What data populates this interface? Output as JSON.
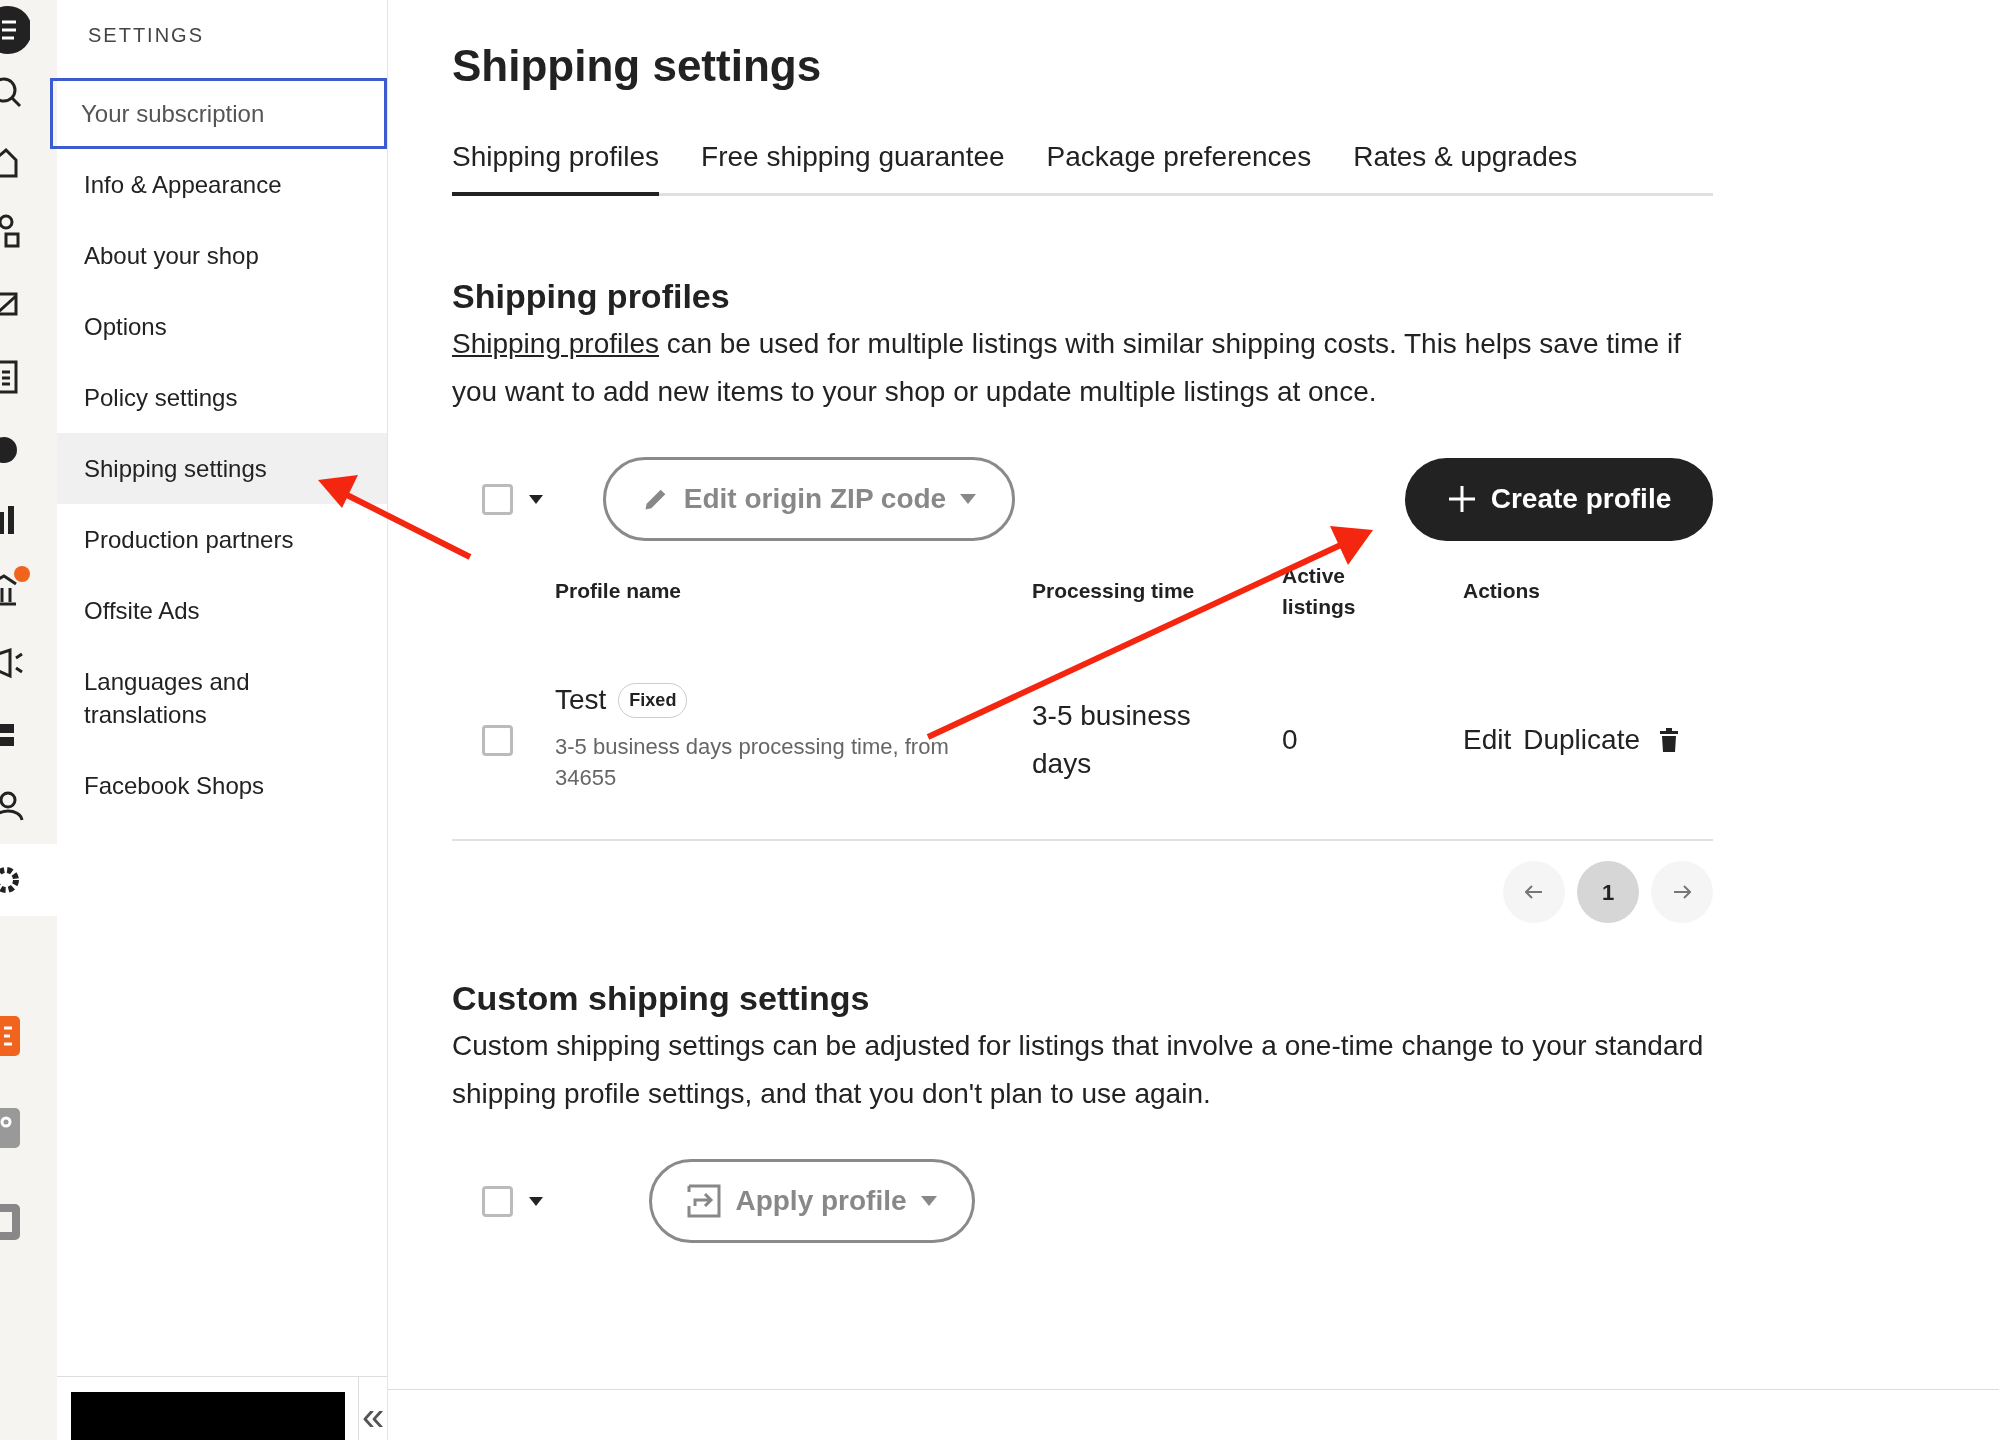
{
  "sidebar": {
    "heading": "SETTINGS",
    "items": [
      {
        "label": "Your subscription",
        "selected": false,
        "focused": true
      },
      {
        "label": "Info & Appearance",
        "selected": false,
        "focused": false
      },
      {
        "label": "About your shop",
        "selected": false,
        "focused": false
      },
      {
        "label": "Options",
        "selected": false,
        "focused": false
      },
      {
        "label": "Policy settings",
        "selected": false,
        "focused": false
      },
      {
        "label": "Shipping settings",
        "selected": true,
        "focused": false
      },
      {
        "label": "Production partners",
        "selected": false,
        "focused": false
      },
      {
        "label": "Offsite Ads",
        "selected": false,
        "focused": false
      },
      {
        "label": "Languages and translations",
        "selected": false,
        "focused": false
      },
      {
        "label": "Facebook Shops",
        "selected": false,
        "focused": false
      }
    ],
    "collapse": "«"
  },
  "page": {
    "title": "Shipping settings"
  },
  "tabs": [
    {
      "label": "Shipping profiles",
      "selected": true
    },
    {
      "label": "Free shipping guarantee",
      "selected": false
    },
    {
      "label": "Package preferences",
      "selected": false
    },
    {
      "label": "Rates & upgrades",
      "selected": false
    }
  ],
  "profiles": {
    "heading": "Shipping profiles",
    "link": "Shipping profiles",
    "text": " can be used for multiple listings with similar shipping costs. This helps save time if you want to add new items to your shop or update multiple listings at once.",
    "select_all": {
      "checked": false
    },
    "zip_button": "Edit origin ZIP code",
    "create_button": "Create profile",
    "columns": [
      "Profile name",
      "Processing time",
      "Active listings",
      "Actions"
    ],
    "rows": [
      {
        "checked": false,
        "name": "Test",
        "badge": "Fixed",
        "description": "3-5 business days processing time, from 34655",
        "processing_time": "3-5 business days",
        "active_listings": "0",
        "actions": [
          "Edit",
          "Duplicate"
        ]
      }
    ],
    "pages": [
      {
        "label": "1",
        "selected": true
      }
    ]
  },
  "custom": {
    "heading": "Custom shipping settings",
    "text": "Custom shipping settings can be adjusted for listings that involve a one-time change to your standard shipping profile settings, and that you don't plan to use again.",
    "select_all": {
      "checked": false
    },
    "apply_button": "Apply profile"
  }
}
